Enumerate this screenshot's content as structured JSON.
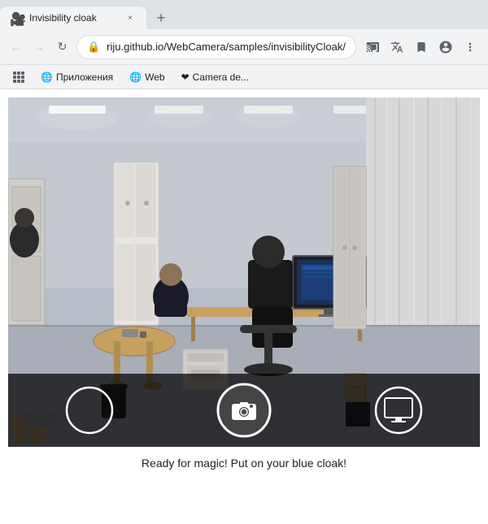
{
  "browser": {
    "tab": {
      "favicon": "🎥",
      "title": "Invisibility cloak",
      "close_label": "×"
    },
    "new_tab_label": "+",
    "toolbar": {
      "back_label": "←",
      "forward_label": "→",
      "refresh_label": "↻",
      "address": "riju.github.io/WebCamera/samples/invisibilityCloak/",
      "camera_icon": "📷",
      "account_icon": "👤",
      "menu_icon": "⋮"
    },
    "bookmarks": [
      {
        "id": "apps",
        "label": ""
      },
      {
        "id": "приложения",
        "label": "Приложения"
      },
      {
        "id": "web",
        "label": "Web"
      },
      {
        "id": "camera",
        "label": "❤ Camera de..."
      }
    ]
  },
  "page": {
    "status_text": "Ready for magic! Put on your blue cloak!",
    "controls": {
      "left_btn_label": "",
      "capture_btn_label": "",
      "right_btn_label": ""
    }
  },
  "colors": {
    "accent": "#ffffff",
    "background": "#000000",
    "control_bg": "rgba(0,0,0,0.75)"
  }
}
